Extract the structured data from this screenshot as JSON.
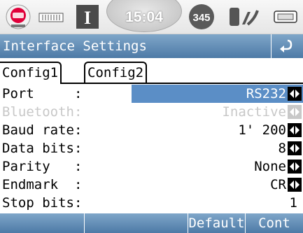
{
  "statusbar": {
    "time": "15:04",
    "satellites": "345",
    "icons": [
      "gps-satellite-icon",
      "battery-indicator-icon",
      "instrument-mode-icon",
      "clock-icon",
      "satellite-count-icon",
      "antenna-icon",
      "keyboard-icon"
    ]
  },
  "window": {
    "title": "Interface Settings"
  },
  "tabs": [
    {
      "label": "Config1"
    },
    {
      "label": "Config2"
    }
  ],
  "rows": [
    {
      "label": "Port     :",
      "value": "RS232",
      "selected": true,
      "enabled": true,
      "has_arrows": true
    },
    {
      "label": "Bluetooth:",
      "value": "Inactive",
      "selected": false,
      "enabled": false,
      "has_arrows": true
    },
    {
      "label": "Baud rate:",
      "value": "1' 200",
      "selected": false,
      "enabled": true,
      "has_arrows": true
    },
    {
      "label": "Data bits:",
      "value": "8",
      "selected": false,
      "enabled": true,
      "has_arrows": true
    },
    {
      "label": "Parity   :",
      "value": "None",
      "selected": false,
      "enabled": true,
      "has_arrows": true
    },
    {
      "label": "Endmark  :",
      "value": "CR",
      "selected": false,
      "enabled": true,
      "has_arrows": true
    },
    {
      "label": "Stop bits:",
      "value": "1",
      "selected": false,
      "enabled": true,
      "has_arrows": false
    }
  ],
  "softkeys": [
    {
      "label": ""
    },
    {
      "label": ""
    },
    {
      "label": "Default"
    },
    {
      "label": "Cont"
    }
  ],
  "colors": {
    "accent": "#5b8ec6",
    "title_bar": "#6a93bd",
    "disabled_text": "#c8c8c8"
  }
}
